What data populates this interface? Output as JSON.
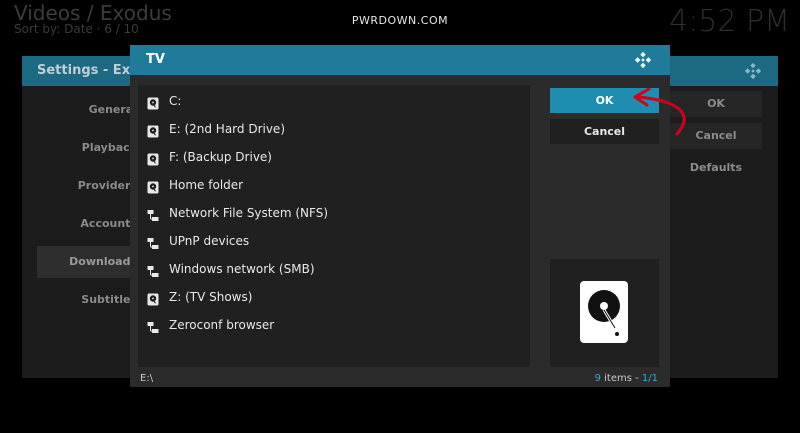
{
  "background": {
    "title": "Videos / Exodus",
    "sort": "Sort by: Date · 6 / 10",
    "clock": "4:52 PM",
    "watermark": "PWRDOWN.COM",
    "settings_title": "Settings - Exodus",
    "sidebar": [
      "General",
      "Playback",
      "Providers",
      "Accounts",
      "Downloads",
      "Subtitles"
    ],
    "right_buttons": {
      "ok": "OK",
      "cancel": "Cancel",
      "defaults": "Defaults"
    }
  },
  "dialog": {
    "title": "TV",
    "items": [
      {
        "label": "C:",
        "icon": "hard-drive-icon"
      },
      {
        "label": "E: (2nd Hard Drive)",
        "icon": "hard-drive-icon"
      },
      {
        "label": "F: (Backup Drive)",
        "icon": "hard-drive-icon"
      },
      {
        "label": "Home folder",
        "icon": "hard-drive-icon"
      },
      {
        "label": "Network File System (NFS)",
        "icon": "network-icon"
      },
      {
        "label": "UPnP devices",
        "icon": "network-icon"
      },
      {
        "label": "Windows network (SMB)",
        "icon": "network-icon"
      },
      {
        "label": "Z: (TV Shows)",
        "icon": "hard-drive-icon"
      },
      {
        "label": "Zeroconf browser",
        "icon": "network-icon"
      }
    ],
    "ok_label": "OK",
    "cancel_label": "Cancel",
    "path": "E:\\",
    "items_count": "9",
    "items_word": " items - ",
    "page": "1/1"
  },
  "colors": {
    "header_blue": "#1f7b99",
    "ok_blue": "#1f8db0",
    "arrow_red": "#d0021b",
    "accent_text": "#3aa6d0"
  }
}
